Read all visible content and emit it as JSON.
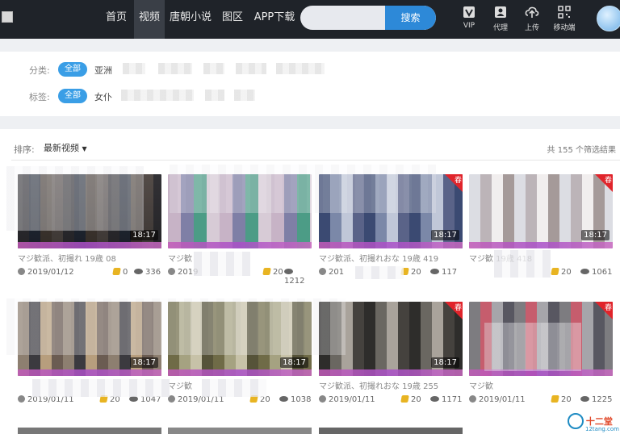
{
  "nav": {
    "items": [
      "首页",
      "视频",
      "唐朝小说",
      "图区",
      "APP下载"
    ],
    "active": "视频"
  },
  "search": {
    "placeholder": "",
    "button_label": "搜索"
  },
  "tools": [
    {
      "label": "VIP",
      "icon": "vip-icon"
    },
    {
      "label": "代理",
      "icon": "agent-icon"
    },
    {
      "label": "上传",
      "icon": "upload-icon"
    },
    {
      "label": "移动端",
      "icon": "qrcode-icon"
    }
  ],
  "filters": {
    "category_label": "分类:",
    "category_all": "全部",
    "category_first": "亚洲",
    "tag_label": "标签:",
    "tag_all": "全部",
    "tag_first": "女仆"
  },
  "results": {
    "sort_label": "排序:",
    "sort_value": "最新视频",
    "count_text": "共 155 个筛选结果"
  },
  "videos": [
    {
      "title": "マジ歓派、初撮れ 19歳 08",
      "duration": "18:17",
      "date": "2019/01/12",
      "coins": "0",
      "views": "336",
      "hot": false
    },
    {
      "title": "マジ歓",
      "duration": "",
      "date": "2019",
      "coins": "20",
      "views": "1212",
      "hot": false
    },
    {
      "title": "マジ歓派、初撮れおな 19歳 419",
      "duration": "18:17",
      "date": "201",
      "coins": "20",
      "views": "117",
      "hot": true
    },
    {
      "title": "マジ歓 19歳 418",
      "duration": "18:17",
      "date": "",
      "coins": "20",
      "views": "1061",
      "hot": true
    },
    {
      "title": "",
      "duration": "18:17",
      "date": "2019/01/11",
      "coins": "20",
      "views": "1047",
      "hot": false
    },
    {
      "title": "マジ歓",
      "duration": "18:17",
      "date": "2019/01/11",
      "coins": "20",
      "views": "1038",
      "hot": false
    },
    {
      "title": "マジ歓派、初撮れおな 19歳 255",
      "duration": "18:17",
      "date": "2019/01/11",
      "coins": "20",
      "views": "1171",
      "hot": true
    },
    {
      "title": "マジ歓",
      "duration": "",
      "date": "2019/01/11",
      "coins": "20",
      "views": "1225",
      "hot": true
    }
  ],
  "watermark": {
    "name": "十二堂",
    "url": "12tang.com"
  },
  "colors": {
    "accent": "#2d89d8",
    "pill": "#3a9ee6",
    "nav_bg": "#1f2329",
    "hot_tag": "#e0242b",
    "coin": "#e8b422"
  }
}
